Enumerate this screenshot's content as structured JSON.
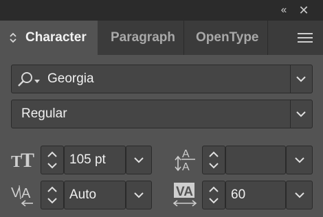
{
  "window": {
    "collapse_icon": "double-chevron-left-icon",
    "close_icon": "close-icon",
    "collapse_glyph": "‹‹",
    "close_glyph": "✕"
  },
  "tabs": [
    {
      "label": "Character",
      "active": true
    },
    {
      "label": "Paragraph",
      "active": false
    },
    {
      "label": "OpenType",
      "active": false
    }
  ],
  "panel_menu_icon": "hamburger-menu-icon",
  "font_family": {
    "value": "Georgia",
    "icon": "search-dropdown-icon"
  },
  "font_style": {
    "value": "Regular"
  },
  "font_size": {
    "value": "105 pt",
    "icon": "font-size-icon"
  },
  "leading": {
    "value": "",
    "icon": "leading-icon"
  },
  "kerning": {
    "value": "Auto",
    "icon": "kerning-icon"
  },
  "tracking": {
    "value": "60",
    "icon": "tracking-icon"
  },
  "colors": {
    "panel_bg": "#535353",
    "tabbar_bg": "#3b3b3b",
    "titlebar_bg": "#2b2b2b",
    "field_bg": "#454545",
    "text": "#f0f0f0"
  }
}
